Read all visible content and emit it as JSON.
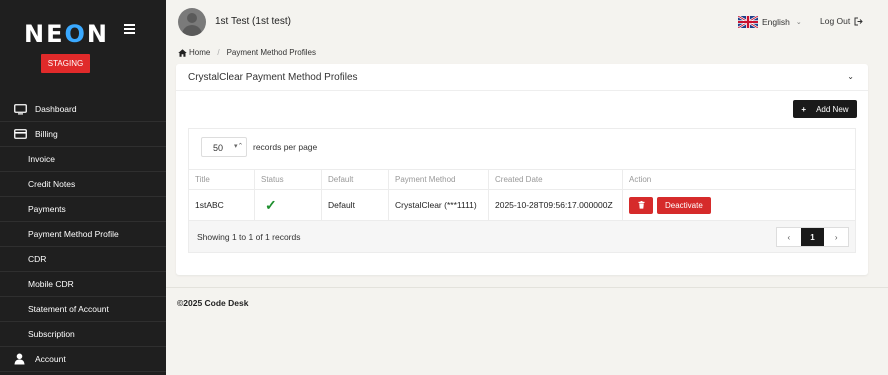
{
  "sidebar": {
    "logo": "NEON",
    "staging_label": "STAGING",
    "items": [
      {
        "label": "Dashboard",
        "icon": "monitor-icon"
      },
      {
        "label": "Billing",
        "icon": "credit-card-icon"
      },
      {
        "label": "Invoice"
      },
      {
        "label": "Credit Notes"
      },
      {
        "label": "Payments"
      },
      {
        "label": "Payment Method Profile"
      },
      {
        "label": "CDR"
      },
      {
        "label": "Mobile CDR"
      },
      {
        "label": "Statement of Account"
      },
      {
        "label": "Subscription"
      },
      {
        "label": "Account",
        "icon": "user-icon"
      }
    ]
  },
  "header": {
    "username": "1st Test (1st test)",
    "language": "English",
    "logout": "Log Out"
  },
  "breadcrumb": {
    "home": "Home",
    "current": "Payment Method Profiles"
  },
  "card": {
    "title": "CrystalClear Payment Method Profiles",
    "add_button": "Add New",
    "records_per_page_value": "50",
    "records_per_page_label": "records per page",
    "columns": [
      "Title",
      "Status",
      "Default",
      "Payment Method",
      "Created Date",
      "Action"
    ],
    "rows": [
      {
        "title": "1stABC",
        "status": "active",
        "default": "Default",
        "payment_method": "CrystalClear (***1111)",
        "created_date": "2025-10-28T09:56:17.000000Z",
        "action_label": "Deactivate"
      }
    ],
    "showing": "Showing 1 to 1 of 1 records",
    "pagination": {
      "prev": "‹",
      "current": "1",
      "next": "›"
    }
  },
  "footer": {
    "copyright": "©2025 Code Desk"
  },
  "colors": {
    "accent_red": "#d62b2b",
    "sidebar_bg": "#1f1f1f",
    "logo_o": "#3aa9ff",
    "success": "#1e8f2e"
  }
}
